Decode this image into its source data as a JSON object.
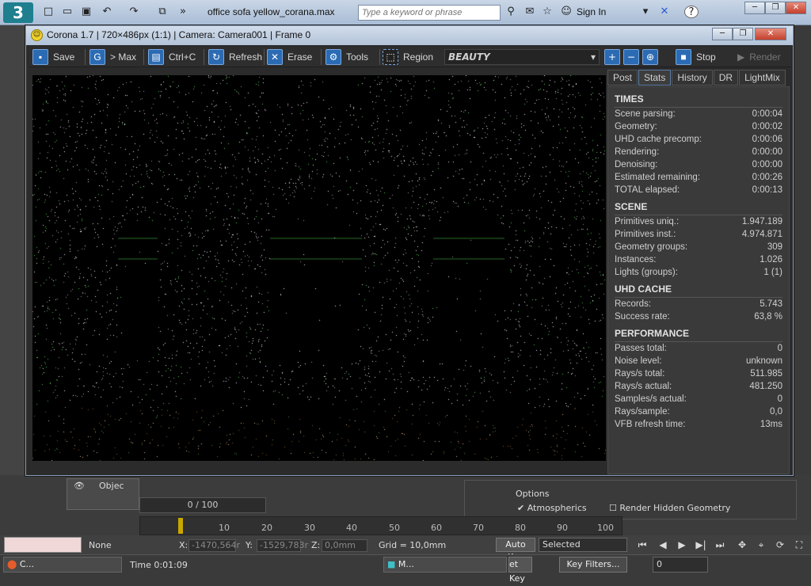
{
  "max": {
    "logo": "3",
    "title": "office sofa yellow_corana.max",
    "search_placeholder": "Type a keyword or phrase",
    "sign_in": "Sign In",
    "help": "?"
  },
  "corona": {
    "title": "Corona 1.7 | 720×486px (1:1) | Camera: Camera001 | Frame 0",
    "toolbar": {
      "save": "Save",
      "to_max": "> Max",
      "copy": "Ctrl+C",
      "refresh": "Refresh",
      "erase": "Erase",
      "tools": "Tools",
      "region": "Region",
      "channel": "BEAUTY",
      "stop": "Stop",
      "render": "Render"
    },
    "tabs": [
      "Post",
      "Stats",
      "History",
      "DR",
      "LightMix"
    ],
    "active_tab": "Stats",
    "stats": {
      "times_title": "TIMES",
      "times": [
        {
          "k": "Scene parsing:",
          "v": "0:00:04"
        },
        {
          "k": "Geometry:",
          "v": "0:00:02"
        },
        {
          "k": "UHD cache precomp:",
          "v": "0:00:06"
        },
        {
          "k": "Rendering:",
          "v": "0:00:00"
        },
        {
          "k": "Denoising:",
          "v": "0:00:00"
        },
        {
          "k": "Estimated remaining:",
          "v": "0:00:26"
        },
        {
          "k": "TOTAL elapsed:",
          "v": "0:00:13"
        }
      ],
      "scene_title": "SCENE",
      "scene": [
        {
          "k": "Primitives uniq.:",
          "v": "1.947.189"
        },
        {
          "k": "Primitives inst.:",
          "v": "4.974.871"
        },
        {
          "k": "Geometry groups:",
          "v": "309"
        },
        {
          "k": "Instances:",
          "v": "1.026"
        },
        {
          "k": "Lights (groups):",
          "v": "1 (1)"
        }
      ],
      "uhd_title": "UHD CACHE",
      "uhd": [
        {
          "k": "Records:",
          "v": "5.743"
        },
        {
          "k": "Success rate:",
          "v": "63,8 %"
        }
      ],
      "perf_title": "PERFORMANCE",
      "perf": [
        {
          "k": "Passes total:",
          "v": "0"
        },
        {
          "k": "Noise level:",
          "v": "unknown"
        },
        {
          "k": "Rays/s total:",
          "v": "511.985"
        },
        {
          "k": "Rays/s actual:",
          "v": "481.250"
        },
        {
          "k": "Samples/s actual:",
          "v": "0"
        },
        {
          "k": "Rays/sample:",
          "v": "0,0"
        },
        {
          "k": "VFB refresh time:",
          "v": "13ms"
        }
      ]
    }
  },
  "bottom": {
    "frame_counter": "0 / 100",
    "ticks": [
      "10",
      "20",
      "30",
      "40",
      "50",
      "60",
      "70",
      "80",
      "90",
      "100"
    ],
    "none_label": "None",
    "x_label": "X:",
    "x_val": "-1470,564r",
    "y_label": "Y:",
    "y_val": "-1529,783r",
    "z_label": "Z:",
    "z_val": "0,0mm",
    "grid": "Grid = 10,0mm",
    "auto_key": "Auto Key",
    "selected": "Selected",
    "set_key": "et Key",
    "key_filters": "Key Filters...",
    "frame_field": "0",
    "time": "Time  0:01:09",
    "options_title": "Options",
    "atmospherics": "Atmospherics",
    "render_hidden": "Render Hidden Geometry",
    "object_label": "Objec",
    "task1": "C...",
    "task2": "M..."
  }
}
